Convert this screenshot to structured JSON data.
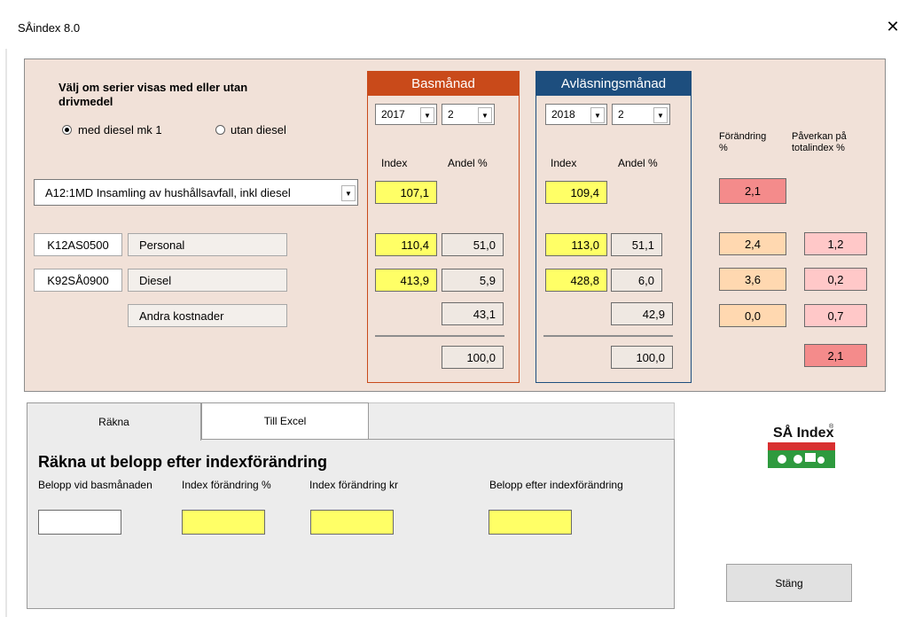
{
  "window": {
    "title": "SÅindex 8.0",
    "close": "✕"
  },
  "choice": {
    "heading_line1": "Välj om serier visas med eller utan",
    "heading_line2": "drivmedel",
    "option_with": "med diesel mk 1",
    "option_without": "utan diesel",
    "selected": "with"
  },
  "series_select": {
    "value": "A12:1MD  Insamling av hushållsavfall, inkl diesel"
  },
  "base": {
    "header": "Basmånad",
    "year": "2017",
    "month": "2",
    "col_index": "Index",
    "col_share": "Andel %",
    "main_index": "107,1",
    "personal_index": "110,4",
    "personal_share": "51,0",
    "diesel_index": "413,9",
    "diesel_share": "5,9",
    "other_share": "43,1",
    "total_share": "100,0",
    "color": "#c94a1a"
  },
  "reading": {
    "header": "Avläsningsmånad",
    "year": "2018",
    "month": "2",
    "col_index": "Index",
    "col_share": "Andel %",
    "main_index": "109,4",
    "personal_index": "113,0",
    "personal_share": "51,1",
    "diesel_index": "428,8",
    "diesel_share": "6,0",
    "other_share": "42,9",
    "total_share": "100,0",
    "color": "#1d4e7e"
  },
  "change": {
    "header_line1": "Förändring",
    "header_line2": "%",
    "main": "2,1",
    "personal": "2,4",
    "diesel": "3,6",
    "other": "0,0"
  },
  "impact": {
    "header_line1": "Påverkan på",
    "header_line2": "totalindex %",
    "personal": "1,2",
    "diesel": "0,2",
    "other": "0,7",
    "total": "2,1"
  },
  "rows": {
    "personal_code": "K12AS0500",
    "personal_label": "Personal",
    "diesel_code": "K92SÅ0900",
    "diesel_label": "Diesel",
    "other_label": "Andra kostnader"
  },
  "tabs": {
    "calculate": "Räkna",
    "excel": "Till Excel",
    "active": "calculate"
  },
  "calc": {
    "heading": "Räkna ut belopp efter indexförändring",
    "label_base_amount": "Belopp vid basmånaden",
    "label_index_change_pct": "Index förändring %",
    "label_index_change_kr": "Index förändring kr",
    "label_amount_after": "Belopp efter indexförändring",
    "base_amount": "",
    "index_change_pct": "",
    "index_change_kr": "",
    "amount_after": ""
  },
  "logo": {
    "text": "SÅ Index",
    "mark": "®"
  },
  "close_button": "Stäng",
  "colors": {
    "panel": "#f1e1d8",
    "highlight": "#ffff66",
    "change": "#ffd8b0",
    "impact": "#ffc8c8",
    "total": "#f48b8b"
  }
}
